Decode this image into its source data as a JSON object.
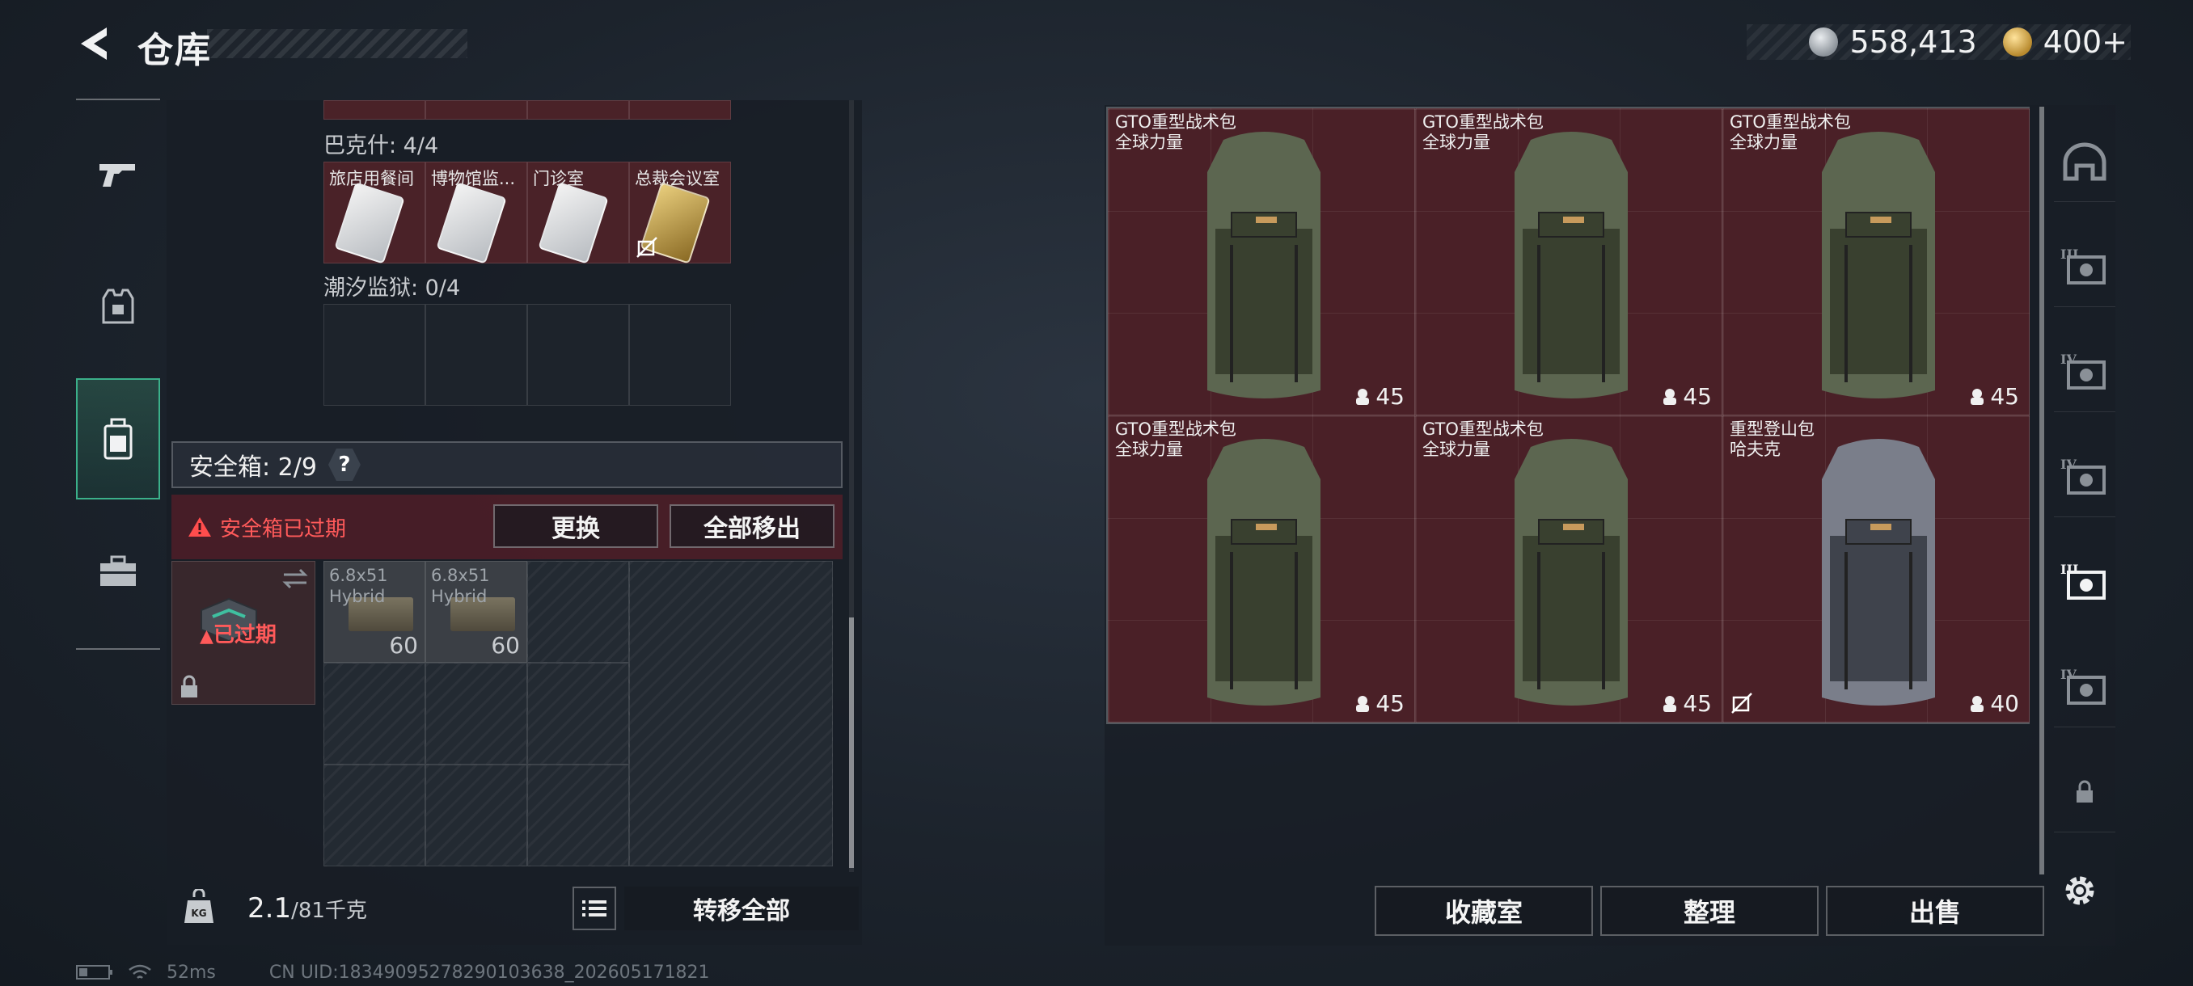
{
  "header": {
    "title": "仓库",
    "currency": [
      {
        "icon": "silver-coin-icon",
        "value": "558,413"
      },
      {
        "icon": "gold-coin-icon",
        "value": "400+"
      }
    ]
  },
  "left_nav": {
    "items": [
      {
        "icon": "gun-icon",
        "active": false
      },
      {
        "icon": "armor-vest-icon",
        "active": false
      },
      {
        "icon": "backpack-icon",
        "active": true
      },
      {
        "icon": "briefcase-icon",
        "active": false
      }
    ]
  },
  "key_sections": [
    {
      "label": "巴克什: 4/4",
      "slots": [
        {
          "name": "旅店用餐间",
          "card": "white",
          "no_trade": false
        },
        {
          "name": "博物馆监...",
          "card": "white",
          "no_trade": false
        },
        {
          "name": "门诊室",
          "card": "white",
          "no_trade": false
        },
        {
          "name": "总裁会议室",
          "card": "gold",
          "no_trade": true
        }
      ]
    },
    {
      "label": "潮汐监狱: 0/4",
      "slots": []
    }
  ],
  "safebox": {
    "title": "安全箱: 2/9",
    "help": "?",
    "expired_warning": "安全箱已过期",
    "replace_button": "更换",
    "remove_all_button": "全部移出",
    "icon_status": "已过期",
    "items": [
      {
        "name_line1": "6.8x51",
        "name_line2": "Hybrid",
        "count": "60"
      },
      {
        "name_line1": "6.8x51",
        "name_line2": "Hybrid",
        "count": "60"
      }
    ]
  },
  "weight": {
    "current": "2.1",
    "max": "/81千克",
    "transfer_all_button": "转移全部"
  },
  "storage": {
    "items": [
      {
        "name_line1": "GTO重型战术包",
        "name_line2": "全球力量",
        "capacity": "45",
        "color": "green",
        "no_trade": false
      },
      {
        "name_line1": "GTO重型战术包",
        "name_line2": "全球力量",
        "capacity": "45",
        "color": "green",
        "no_trade": false
      },
      {
        "name_line1": "GTO重型战术包",
        "name_line2": "全球力量",
        "capacity": "45",
        "color": "green",
        "no_trade": false
      },
      {
        "name_line1": "GTO重型战术包",
        "name_line2": "全球力量",
        "capacity": "45",
        "color": "green",
        "no_trade": false
      },
      {
        "name_line1": "GTO重型战术包",
        "name_line2": "全球力量",
        "capacity": "45",
        "color": "green",
        "no_trade": false
      },
      {
        "name_line1": "重型登山包",
        "name_line2": "哈夫克",
        "capacity": "40",
        "color": "grey",
        "no_trade": true
      }
    ],
    "collection_button": "收藏室",
    "sort_button": "整理",
    "sell_button": "出售"
  },
  "right_nav": {
    "items": [
      {
        "icon": "helmet-icon",
        "label": ""
      },
      {
        "icon": "tier3-storage-icon",
        "label": "III"
      },
      {
        "icon": "tier4-storage-icon",
        "label": "IV"
      },
      {
        "icon": "tier4-folder-icon",
        "label": "IV"
      },
      {
        "icon": "tier3-safebox-icon",
        "label": "III"
      },
      {
        "icon": "tier4-add-storage-icon",
        "label": "IV"
      },
      {
        "icon": "lock-icon",
        "label": ""
      }
    ]
  },
  "status": {
    "ping": "52ms",
    "uid": "CN UID:1834909527829010363​8_202605171821"
  }
}
